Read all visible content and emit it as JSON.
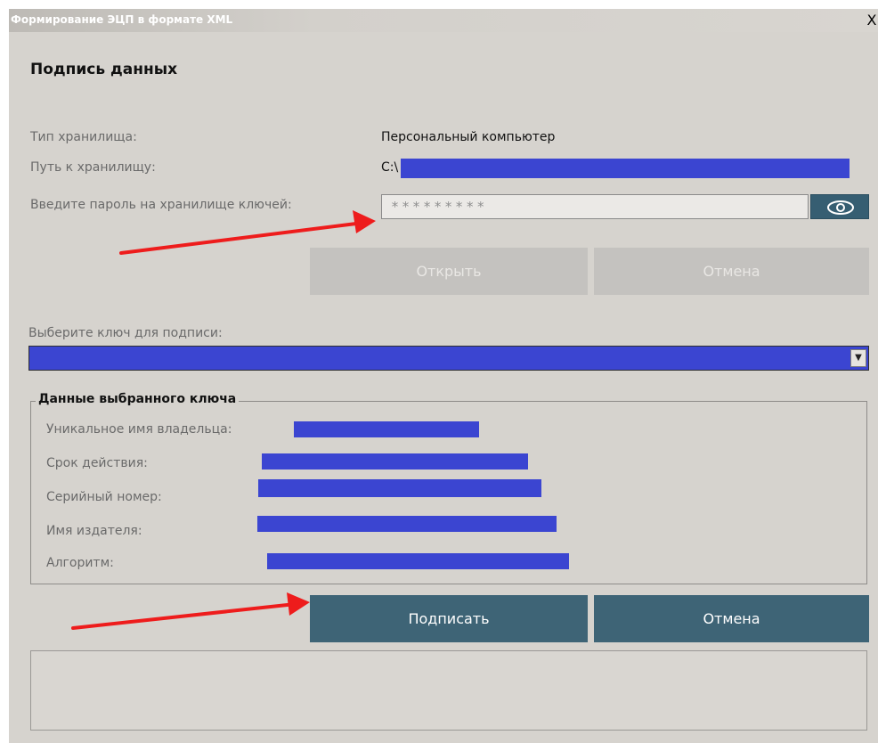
{
  "window": {
    "title": "Формирование ЭЦП в формате XML",
    "close_label": "X"
  },
  "heading": "Подпись данных",
  "storage": {
    "type_label": "Тип хранилища:",
    "type_value": "Персональный компьютер",
    "path_label": "Путь к хранилищу:",
    "path_value": "C:\\",
    "password_label": "Введите пароль на хранилище ключей:",
    "password_value": "*********"
  },
  "buttons": {
    "open_label": "Открыть",
    "cancel_top_label": "Отмена",
    "sign_label": "Подписать",
    "cancel_bottom_label": "Отмена"
  },
  "key_select": {
    "label": "Выберите ключ для подписи:"
  },
  "key_details": {
    "title": "Данные выбранного ключа",
    "fields": [
      {
        "label": "Уникальное имя владельца:"
      },
      {
        "label": "Срок действия:"
      },
      {
        "label": "Серийный номер:"
      },
      {
        "label": "Имя издателя:"
      },
      {
        "label": "Алгоритм:"
      }
    ]
  },
  "colors": {
    "redaction": "#3b45d1",
    "primary_button": "#3e6476",
    "annotation_arrow": "#ee1c1c"
  },
  "icons": {
    "eye": "eye-icon",
    "dropdown": "chevron-down-icon"
  }
}
